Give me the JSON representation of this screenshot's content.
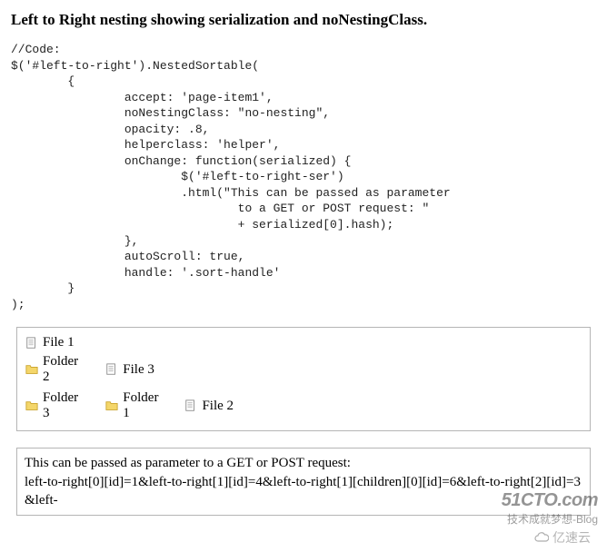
{
  "title": "Left to Right nesting showing serialization and noNestingClass.",
  "code": "//Code:\n$('#left-to-right').NestedSortable(\n        {\n                accept: 'page-item1',\n                noNestingClass: \"no-nesting\",\n                opacity: .8,\n                helperclass: 'helper',\n                onChange: function(serialized) {\n                        $('#left-to-right-ser')\n                        .html(\"This can be passed as parameter\n                                to a GET or POST request: \"\n                                + serialized[0].hash);\n                },\n                autoScroll: true,\n                handle: '.sort-handle'\n        }\n);",
  "tree": {
    "file1": "File 1",
    "folder2": "Folder 2",
    "file3": "File 3",
    "folder3": "Folder 3",
    "folder1": "Folder 1",
    "file2": "File 2"
  },
  "output": {
    "line1": "This can be passed as parameter to a GET or POST request:",
    "line2": "left-to-right[0][id]=1&left-to-right[1][id]=4&left-to-right[1][children][0][id]=6&left-to-right[2][id]=3&left-"
  },
  "watermark": {
    "top": "51CTO.com",
    "bottom": "技术成就梦想-Blog",
    "cloud": "亿速云"
  }
}
